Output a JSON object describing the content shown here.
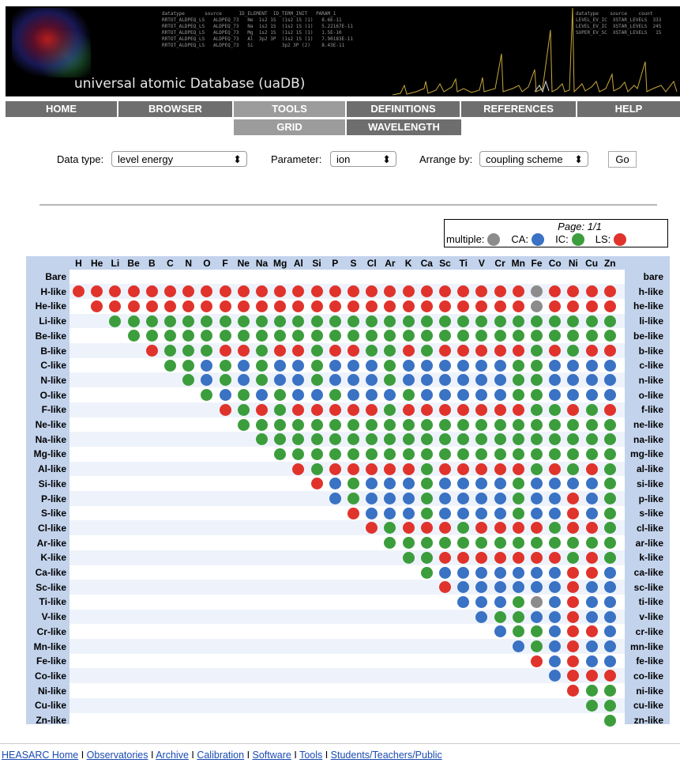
{
  "banner": {
    "title": "universal atomic Database (uaDB)",
    "code_left": "datatype       source      ID_ELEMENT  ID_TERM_INIT   PARAM_1\nRRTOT_ALDPEQ_LS   ALDPEQ_73   Ne  1s2 1S  (1s2 1S (1)   8.6E-11\nRRTOT_ALDPEQ_LS   ALDPEQ_73   Na  1s2 1S  (1s2 1S (1)   5.22167E-11\nRRTOT_ALDPEQ_LS   ALDPEQ_73   Mg  1s2 1S  (1s2 1S (1)   1.5E-10\nRRTOT_ALDPEQ_LS   ALDPEQ_73   Al  3p2 3P  (1s2 1S (1)   7.90183E-11\nRRTOT_ALDPEQ_LS   ALDPEQ_73   Si          3p2 3P (2)    8.43E-11",
    "code_right": "datatype    source    count\nLEVEL_EV_IC  XSTAR_LEVELS  333\nLEVEL_EV_IC  XSTAR_LEVELS  245\nSUPER_EV_SC  XSTAR_LEVELS   15"
  },
  "nav": {
    "main": [
      "HOME",
      "BROWSER",
      "TOOLS",
      "DEFINITIONS",
      "REFERENCES",
      "HELP"
    ],
    "sub": [
      "GRID",
      "WAVELENGTH"
    ]
  },
  "controls": {
    "datatype_label": "Data type:",
    "datatype_value": "level energy",
    "parameter_label": "Parameter:",
    "parameter_value": "ion",
    "arrange_label": "Arrange by:",
    "arrange_value": "coupling scheme",
    "go_label": "Go"
  },
  "legend": {
    "page": "Page: 1/1",
    "items": [
      {
        "label": "multiple:",
        "color": "#8c8c8c"
      },
      {
        "label": "CA:",
        "color": "#3a72c4"
      },
      {
        "label": "IC:",
        "color": "#3c9d3c"
      },
      {
        "label": "LS:",
        "color": "#e0332c"
      }
    ]
  },
  "colors": {
    "M": "#8c8c8c",
    "C": "#3a72c4",
    "I": "#3c9d3c",
    "L": "#e0332c"
  },
  "grid": {
    "elements": [
      "H",
      "He",
      "Li",
      "Be",
      "B",
      "C",
      "N",
      "O",
      "F",
      "Ne",
      "Na",
      "Mg",
      "Al",
      "Si",
      "P",
      "S",
      "Cl",
      "Ar",
      "K",
      "Ca",
      "Sc",
      "Ti",
      "V",
      "Cr",
      "Mn",
      "Fe",
      "Co",
      "Ni",
      "Cu",
      "Zn"
    ],
    "rows_left": [
      "Bare",
      "H-like",
      "He-like",
      "Li-like",
      "Be-like",
      "B-like",
      "C-like",
      "N-like",
      "O-like",
      "F-like",
      "Ne-like",
      "Na-like",
      "Mg-like",
      "Al-like",
      "Si-like",
      "P-like",
      "S-like",
      "Cl-like",
      "Ar-like",
      "K-like",
      "Ca-like",
      "Sc-like",
      "Ti-like",
      "V-like",
      "Cr-like",
      "Mn-like",
      "Fe-like",
      "Co-like",
      "Ni-like",
      "Cu-like",
      "Zn-like"
    ],
    "rows_right": [
      "bare",
      "h-like",
      "he-like",
      "li-like",
      "be-like",
      "b-like",
      "c-like",
      "n-like",
      "o-like",
      "f-like",
      "ne-like",
      "na-like",
      "mg-like",
      "al-like",
      "si-like",
      "p-like",
      "s-like",
      "cl-like",
      "ar-like",
      "k-like",
      "ca-like",
      "sc-like",
      "ti-like",
      "v-like",
      "cr-like",
      "mn-like",
      "fe-like",
      "co-like",
      "ni-like",
      "cu-like",
      "zn-like"
    ],
    "cells": [
      "",
      "LLLLLLLLLLLLLLLLLLLLLLLLLMLLLL",
      ".LLLLLLLLLLLLLLLLLLLLLLLLMLLLL",
      "..IIIIIIIIIIIIIIIIIIIIIIIIIIII",
      "...IIIIIIIIIIIIIIIIIIIIIIIIIII",
      "....LIIILLILLILLIILILLLLLILILL",
      ".....IICICICCICCCICCCCCCIICCCC",
      "......ICICICCICCCICCCCCCIICCCC",
      ".......ICICICCICCCICCCCCIICCCC",
      "........LILILLLLLILLLLLLLIILIL",
      ".........IIIIIIIIIIIIIIIIIIIII",
      "..........IIIIIIIIIIIIIIIIIIII",
      "...........IIIIIIIIIIIIIIIIIII",
      "............LILLLLLILLLLLILILI",
      ".............LCICCCICCCCICCCCI",
      "..............CICCCICCCCICCLCI",
      "...............LCCCICCCCICCLCI",
      "................LILLLILLLLILLI",
      ".................IIIIIIIIIIIII",
      "..................IILLLLLLLILI",
      "...................ICCCCCCCLLC",
      "....................LCCCCCCLCC",
      ".....................CCCIMCLCC",
      "......................CIICCLCC",
      ".......................CIICLLC",
      "........................CICLCC",
      ".........................LCLCC",
      "..........................CLLL",
      "...........................LII",
      "............................II",
      ".............................I"
    ]
  },
  "footer": {
    "links": [
      "HEASARC Home",
      "Observatories",
      "Archive",
      "Calibration",
      "Software",
      "Tools",
      "Students/Teachers/Public"
    ],
    "sep": " I "
  }
}
